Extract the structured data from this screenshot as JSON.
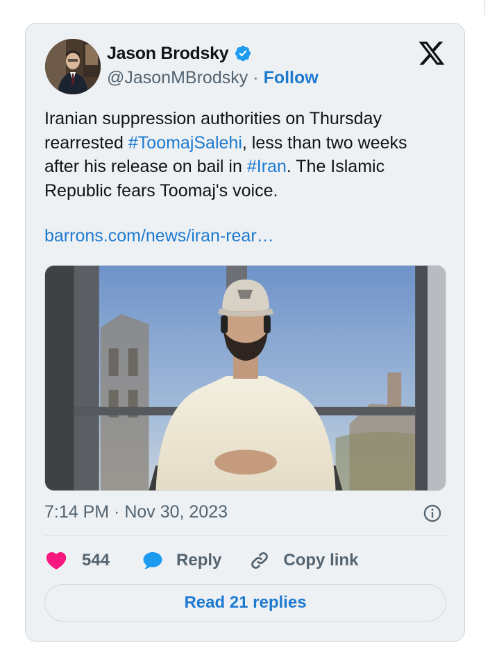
{
  "author": {
    "display_name": "Jason Brodsky",
    "handle": "@JasonMBrodsky",
    "separator": "·",
    "follow_label": "Follow",
    "verified": true
  },
  "tweet": {
    "text_parts": {
      "p1": "Iranian suppression authorities on Thursday rearrested ",
      "tag1": "#ToomajSalehi",
      "p2": ", less than two weeks after his release on bail in ",
      "tag2": "#Iran",
      "p3": ". The Islamic Republic fears Toomaj's voice."
    },
    "link": "barrons.com/news/iran-rear…",
    "timestamp": "7:14 PM · Nov 30, 2023"
  },
  "actions": {
    "like_count": "544",
    "reply_label": "Reply",
    "copy_link_label": "Copy link",
    "read_replies_label": "Read 21 replies"
  },
  "colors": {
    "accent": "#1d7ad0",
    "like": "#f91880",
    "muted": "#536471",
    "card_bg": "#eef1f4"
  },
  "icons": [
    "verified-badge-icon",
    "x-logo-icon",
    "info-icon",
    "heart-icon",
    "speech-bubble-icon",
    "link-icon"
  ]
}
